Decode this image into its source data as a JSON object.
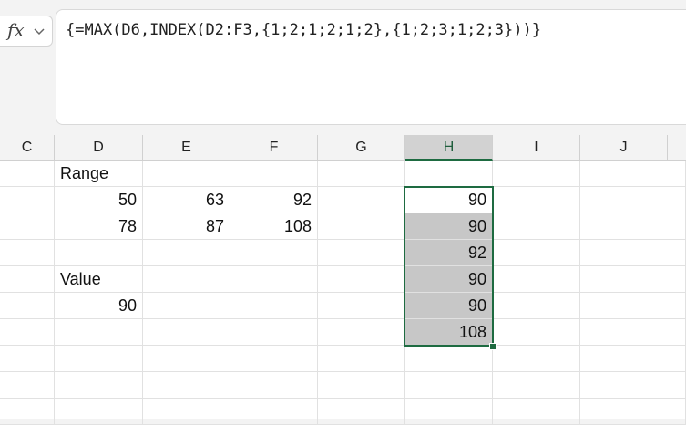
{
  "formula_bar": {
    "fx_label": "fx",
    "formula": "{=MAX(D6,INDEX(D2:F3,{1;2;1;2;1;2},{1;2;3;1;2;3}))}"
  },
  "columns": [
    "C",
    "D",
    "E",
    "F",
    "G",
    "H",
    "I",
    "J"
  ],
  "selected_column": "H",
  "cells": {
    "D1": "Range",
    "D2": "50",
    "E2": "63",
    "F2": "92",
    "D3": "78",
    "E3": "87",
    "F3": "108",
    "D5": "Value",
    "D6": "90",
    "H2": "90",
    "H3": "90",
    "H4": "92",
    "H5": "90",
    "H6": "90",
    "H7": "108"
  },
  "colors": {
    "selection_border": "#1e6b41",
    "selected_fill": "#c7c7c7",
    "header_selected_fill": "#d2d2d2"
  }
}
